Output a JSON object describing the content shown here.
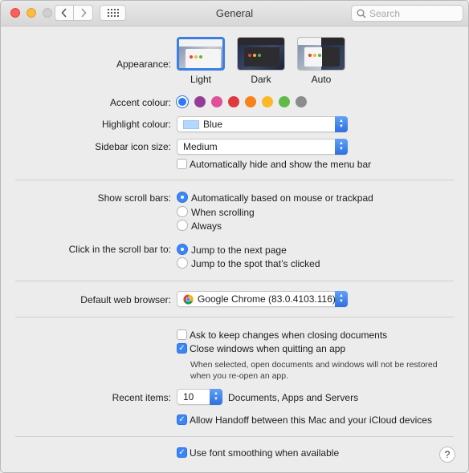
{
  "window": {
    "title": "General"
  },
  "search": {
    "placeholder": "Search"
  },
  "appearance": {
    "label": "Appearance:",
    "options": [
      {
        "name": "Light",
        "selected": true
      },
      {
        "name": "Dark",
        "selected": false
      },
      {
        "name": "Auto",
        "selected": false
      }
    ]
  },
  "accent": {
    "label": "Accent colour:",
    "colors": [
      "#2f7bf5",
      "#953d96",
      "#e04f9b",
      "#e0383e",
      "#f7821b",
      "#fcb827",
      "#62ba46",
      "#8c8c8c"
    ],
    "selected_index": 0
  },
  "highlight": {
    "label": "Highlight colour:",
    "value": "Blue",
    "swatch_color": "#b3d7ff"
  },
  "sidebar_icon_size": {
    "label": "Sidebar icon size:",
    "value": "Medium"
  },
  "menu_bar": {
    "label": "Automatically hide and show the menu bar",
    "checked": false
  },
  "scroll_bars": {
    "label": "Show scroll bars:",
    "options": [
      {
        "label": "Automatically based on mouse or trackpad",
        "selected": true
      },
      {
        "label": "When scrolling",
        "selected": false
      },
      {
        "label": "Always",
        "selected": false
      }
    ]
  },
  "click_scroll": {
    "label": "Click in the scroll bar to:",
    "options": [
      {
        "label": "Jump to the next page",
        "selected": true
      },
      {
        "label": "Jump to the spot that’s clicked",
        "selected": false
      }
    ]
  },
  "browser": {
    "label": "Default web browser:",
    "value": "Google Chrome (83.0.4103.116)"
  },
  "ask_keep": {
    "label": "Ask to keep changes when closing documents",
    "checked": false
  },
  "close_windows": {
    "label": "Close windows when quitting an app",
    "checked": true,
    "note": "When selected, open documents and windows will not be restored when you re-open an app."
  },
  "recent_items": {
    "label": "Recent items:",
    "value": "10",
    "suffix": "Documents, Apps and Servers"
  },
  "handoff": {
    "label": "Allow Handoff between this Mac and your iCloud devices",
    "checked": true
  },
  "font_smoothing": {
    "label": "Use font smoothing when available",
    "checked": true
  },
  "help": {
    "label": "?"
  }
}
